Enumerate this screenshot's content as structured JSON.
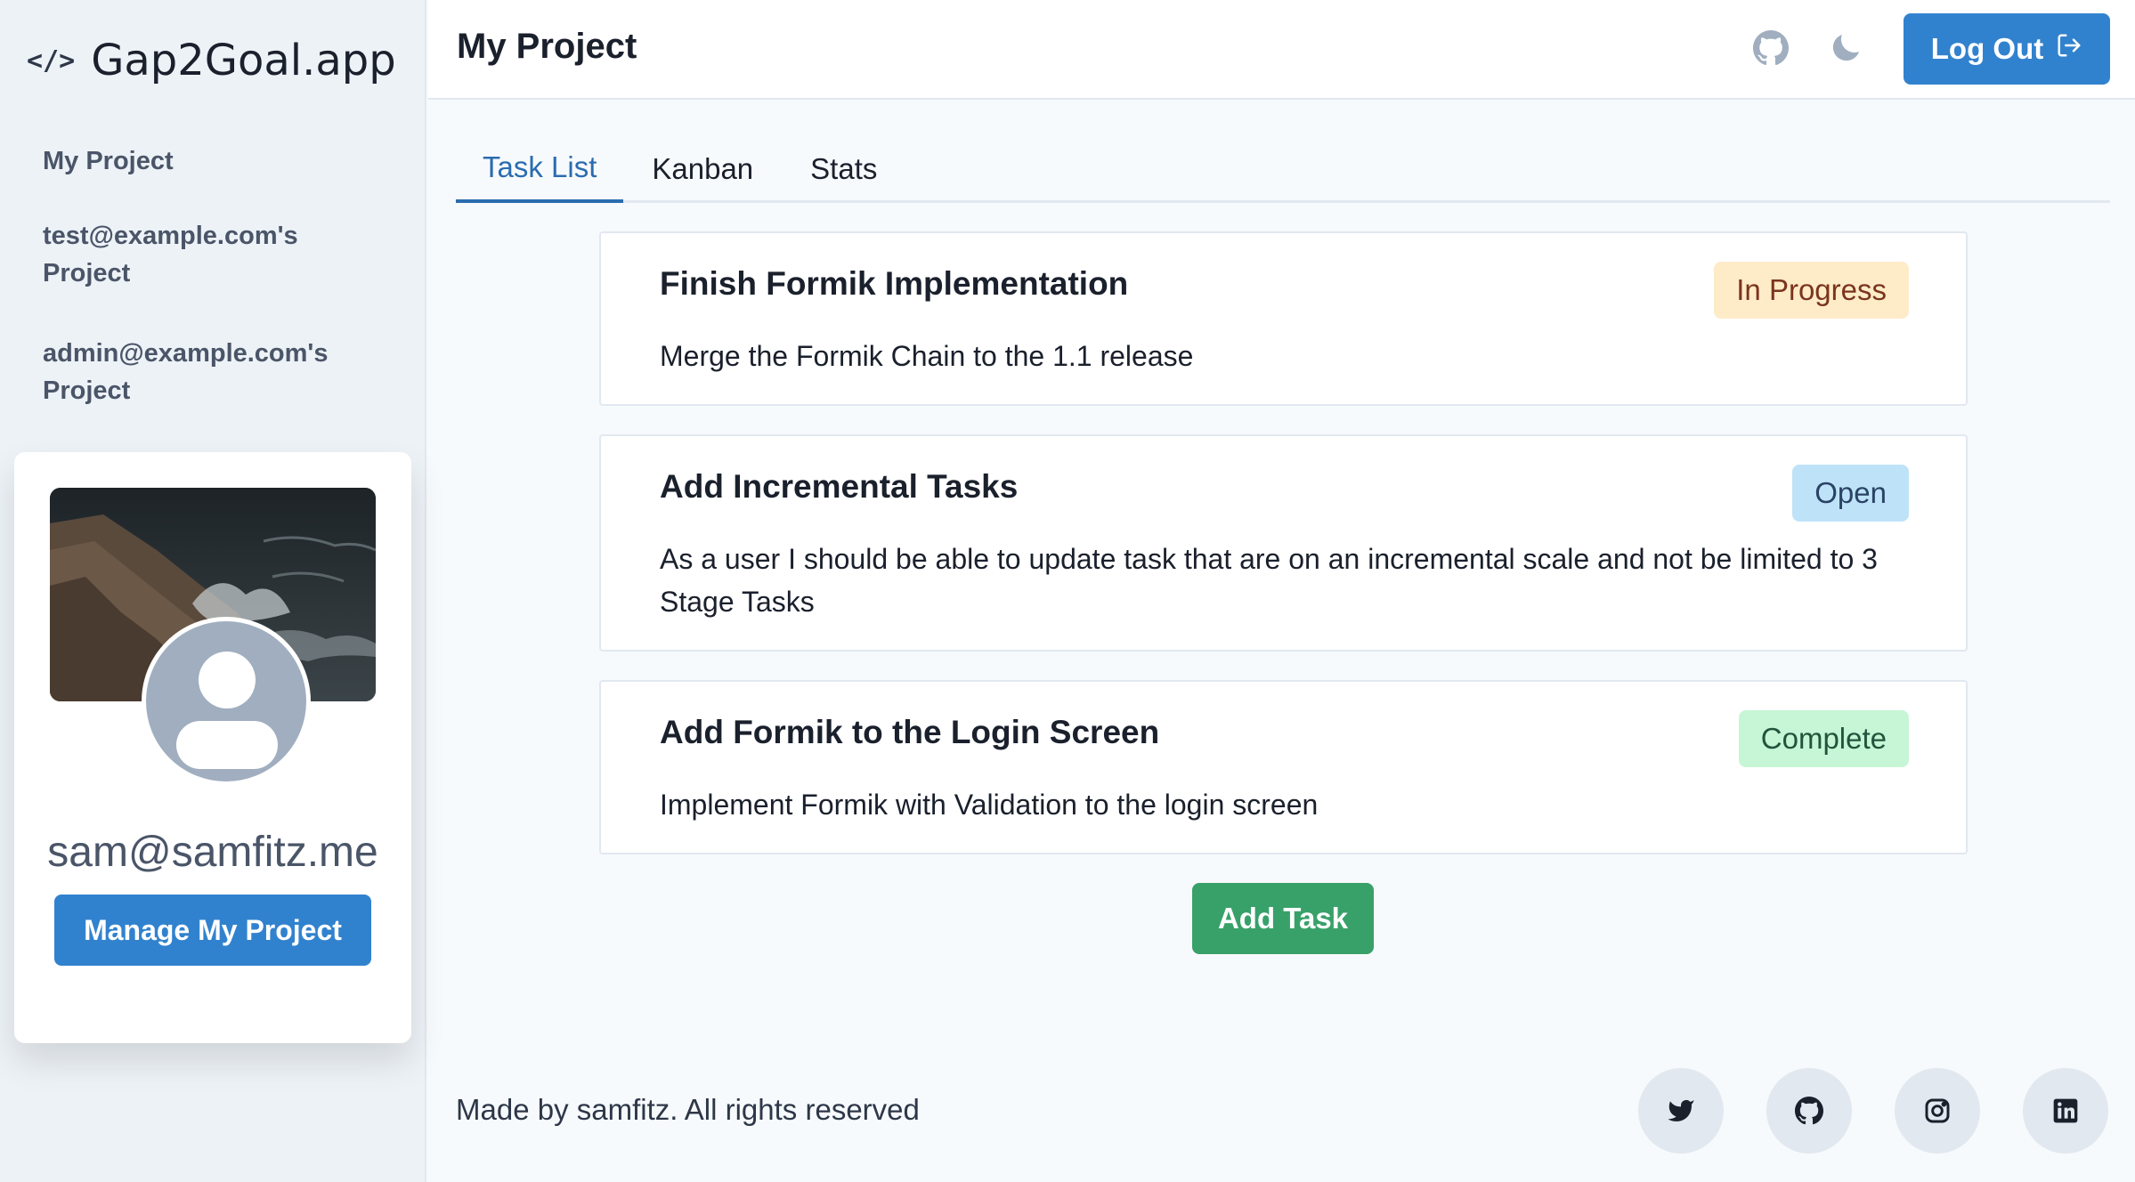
{
  "brand": {
    "icon": "code-icon",
    "icon_glyph": "</>",
    "name": "Gap2Goal.app"
  },
  "sidebar": {
    "items": [
      {
        "label": "My Project"
      },
      {
        "label": "test@example.com's Project"
      },
      {
        "label": "admin@example.com's Project"
      }
    ]
  },
  "profile": {
    "email": "sam@samfitz.me",
    "manage_label": "Manage My Project"
  },
  "header": {
    "title": "My Project",
    "github_icon": "github-icon",
    "theme_icon": "moon-icon",
    "logout_label": "Log Out",
    "logout_icon": "sign-out-icon"
  },
  "tabs": [
    {
      "label": "Task List",
      "active": true
    },
    {
      "label": "Kanban",
      "active": false
    },
    {
      "label": "Stats",
      "active": false
    }
  ],
  "tasks": [
    {
      "title": "Finish Formik Implementation",
      "description": "Merge the Formik Chain to the 1.1 release",
      "status": "In Progress",
      "status_bg": "#feebc8",
      "status_color": "#7b341e"
    },
    {
      "title": "Add Incremental Tasks",
      "description": "As a user I should be able to update task that are on an incremental scale and not be limited to 3 Stage Tasks",
      "status": "Open",
      "status_bg": "#bee3f8",
      "status_color": "#2a4365"
    },
    {
      "title": "Add Formik to the Login Screen",
      "description": "Implement Formik with Validation to the login screen",
      "status": "Complete",
      "status_bg": "#c6f6d5",
      "status_color": "#22543d"
    }
  ],
  "add_task_label": "Add Task",
  "footer": {
    "text": "Made by samfitz. All rights reserved",
    "social": [
      "twitter-icon",
      "github-icon",
      "instagram-icon",
      "linkedin-icon"
    ]
  },
  "colors": {
    "primary": "#3182ce",
    "success": "#38a169",
    "sidebar_bg": "#edf2f7"
  }
}
